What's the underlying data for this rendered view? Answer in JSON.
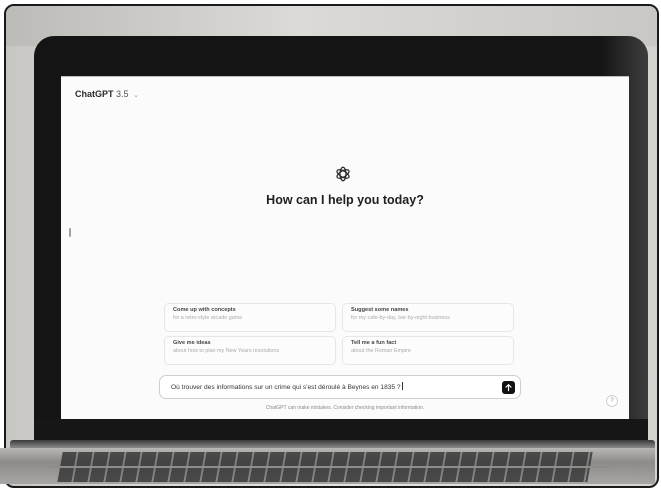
{
  "app": {
    "model_name": "ChatGPT",
    "model_version": "3.5",
    "model_chevron": "⌄"
  },
  "main": {
    "headline": "How can I help you today?"
  },
  "suggestions": [
    {
      "title": "Come up with concepts",
      "subtitle": "for a retro-style arcade game"
    },
    {
      "title": "Suggest some names",
      "subtitle": "for my cafe-by-day, bar-by-night business"
    },
    {
      "title": "Give me ideas",
      "subtitle": "about how to plan my New Years resolutions"
    },
    {
      "title": "Tell me a fun fact",
      "subtitle": "about the Roman Empire"
    }
  ],
  "composer": {
    "value": "Où trouver des informations sur un crime qui s'est déroulé à Beynes en 1835 ?"
  },
  "footer": {
    "disclaimer": "ChatGPT can make mistakes. Consider checking important information."
  },
  "help": {
    "label": "?"
  },
  "icons": {
    "logo": "openai-logo-icon",
    "send": "arrow-up-icon"
  },
  "colors": {
    "send_button": "#111111",
    "page_background": "#fbfbfb"
  }
}
